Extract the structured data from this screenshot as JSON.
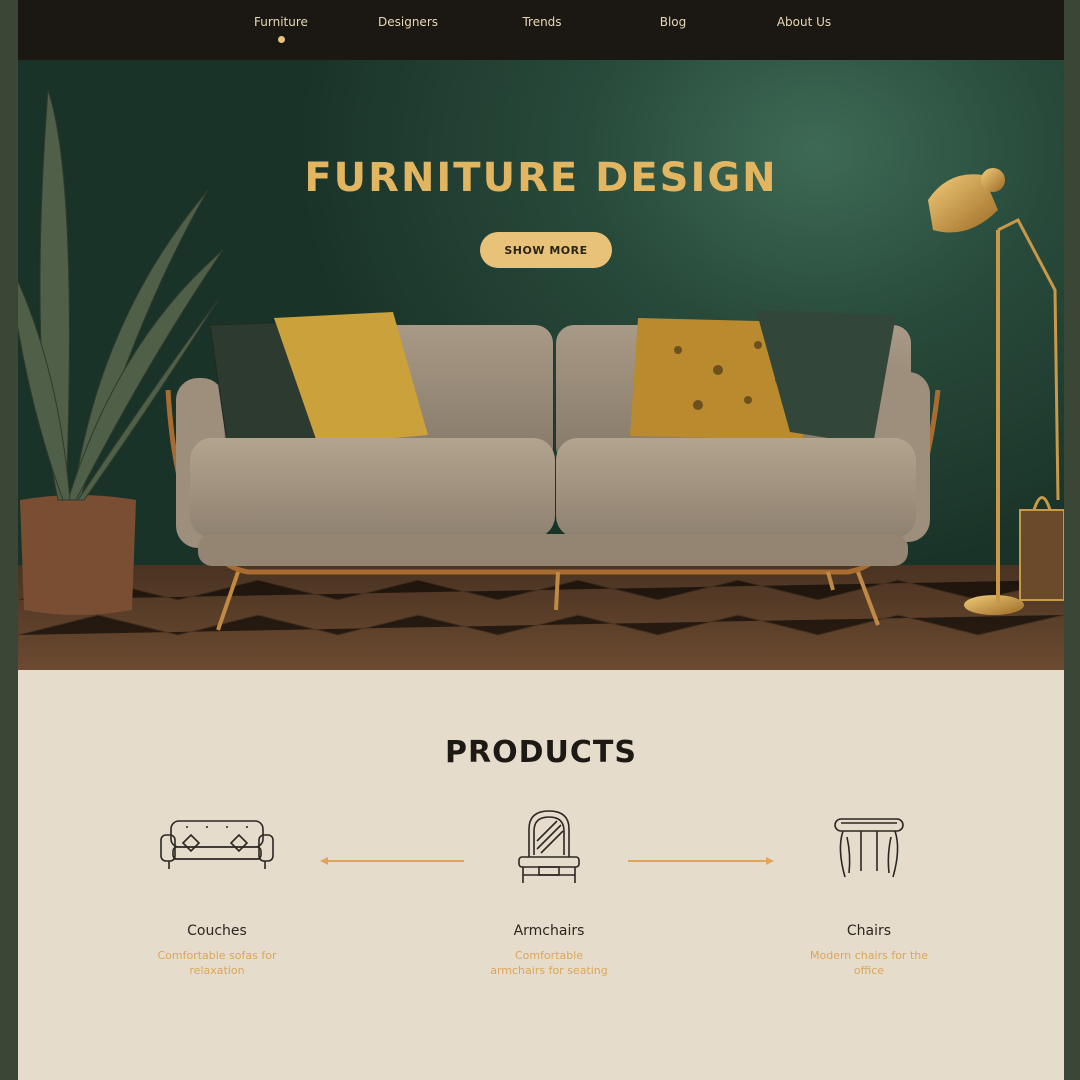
{
  "nav": {
    "items": [
      {
        "label": "Furniture",
        "active": true
      },
      {
        "label": "Designers",
        "active": false
      },
      {
        "label": "Trends",
        "active": false
      },
      {
        "label": "Blog",
        "active": false
      },
      {
        "label": "About Us",
        "active": false
      }
    ]
  },
  "hero": {
    "title": "FURNITURE DESIGN",
    "button_label": "SHOW MORE"
  },
  "products": {
    "title": "PRODUCTS",
    "items": [
      {
        "name": "Couches",
        "description": "Comfortable sofas for relaxation",
        "icon": "couch-icon"
      },
      {
        "name": "Armchairs",
        "description": "Comfortable armchairs for seating",
        "icon": "armchair-icon"
      },
      {
        "name": "Chairs",
        "description": "Modern chairs for the office",
        "icon": "chair-icon"
      }
    ]
  },
  "colors": {
    "nav_bg": "#1b1814",
    "hero_green": "#284a3b",
    "accent_gold": "#e2b560",
    "page_beige": "#e6dccb"
  }
}
